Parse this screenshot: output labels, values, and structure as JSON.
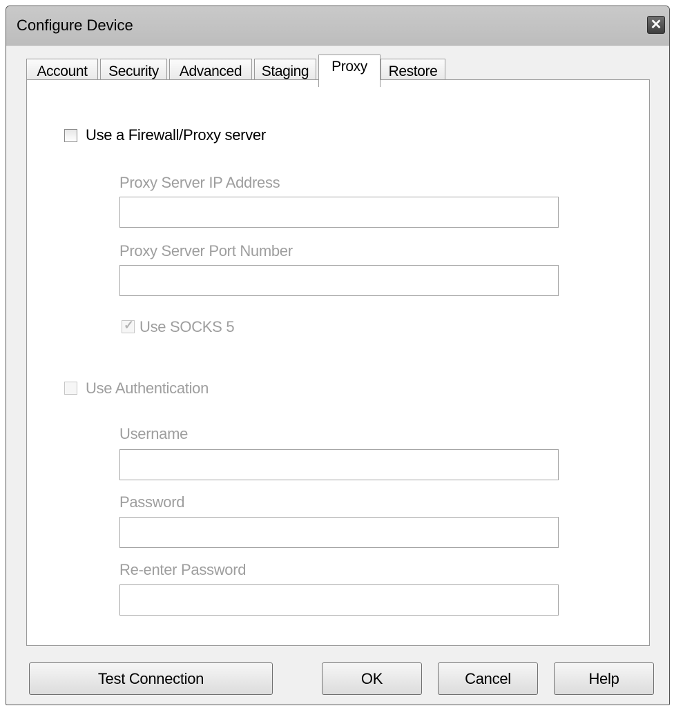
{
  "window": {
    "title": "Configure Device",
    "close_glyph": "✕"
  },
  "tabs": [
    {
      "label": "Account",
      "active": false
    },
    {
      "label": "Security",
      "active": false
    },
    {
      "label": "Advanced",
      "active": false
    },
    {
      "label": "Staging",
      "active": false
    },
    {
      "label": "Proxy",
      "active": true
    },
    {
      "label": "Restore",
      "active": false
    }
  ],
  "proxy": {
    "use_proxy": {
      "label": "Use a Firewall/Proxy server",
      "checked": false,
      "enabled": true
    },
    "ip": {
      "label": "Proxy Server IP Address",
      "value": "",
      "enabled": false
    },
    "port": {
      "label": "Proxy Server Port Number",
      "value": "",
      "enabled": false
    },
    "socks5": {
      "label": "Use SOCKS 5",
      "checked": true,
      "enabled": false,
      "check_glyph": "✓"
    },
    "use_auth": {
      "label": "Use Authentication",
      "checked": false,
      "enabled": false
    },
    "username": {
      "label": "Username",
      "value": "",
      "enabled": false
    },
    "password": {
      "label": "Password",
      "value": "",
      "enabled": false
    },
    "reenter_password": {
      "label": "Re-enter Password",
      "value": "",
      "enabled": false
    }
  },
  "buttons": {
    "test_connection": "Test Connection",
    "ok": "OK",
    "cancel": "Cancel",
    "help": "Help"
  }
}
